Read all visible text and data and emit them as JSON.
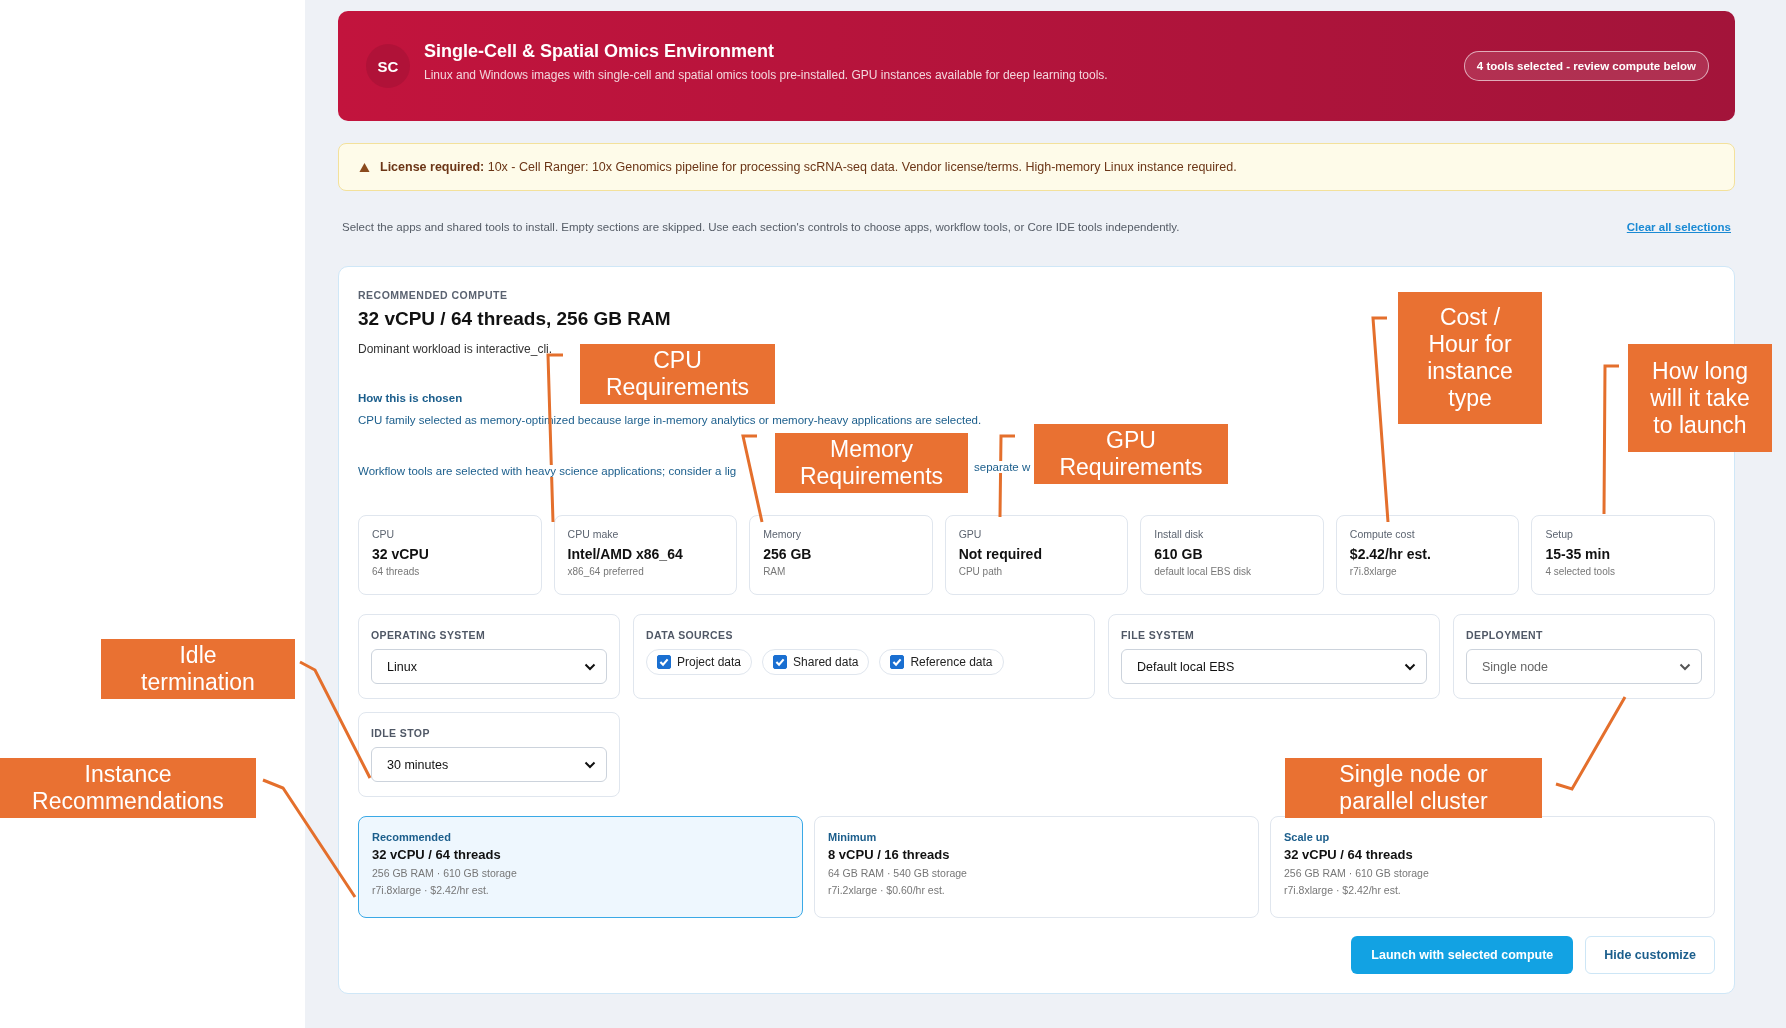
{
  "header": {
    "logo": "SC",
    "title": "Single-Cell & Spatial Omics Environment",
    "subtitle": "Linux and Windows images with single-cell and spatial omics tools pre-installed. GPU instances available for deep learning tools.",
    "badge": "4 tools selected - review compute below"
  },
  "license": {
    "label": "License required:",
    "text": "10x - Cell Ranger: 10x Genomics pipeline for processing scRNA-seq data. Vendor license/terms. High-memory Linux instance required."
  },
  "intro": "Select the apps and shared tools to install. Empty sections are skipped. Use each section's controls to choose apps, workflow tools, or Core IDE tools independently.",
  "clear_link": "Clear all selections",
  "compute": {
    "section_label": "RECOMMENDED COMPUTE",
    "title": "32 vCPU / 64 threads, 256 GB RAM",
    "dominant": "Dominant workload is interactive_cli.",
    "how_heading": "How this is chosen",
    "cpu_note": "CPU family selected as memory-optimized because large in-memory analytics or memory-heavy applications are selected.",
    "workflow_note": [
      "Workflow tools are selected with heavy science applications; consider a lig",
      "separate w"
    ]
  },
  "metrics": [
    {
      "label": "CPU",
      "value": "32 vCPU",
      "sub": "64 threads"
    },
    {
      "label": "CPU make",
      "value": "Intel/AMD x86_64",
      "sub": "x86_64 preferred"
    },
    {
      "label": "Memory",
      "value": "256 GB",
      "sub": "RAM"
    },
    {
      "label": "GPU",
      "value": "Not required",
      "sub": "CPU path"
    },
    {
      "label": "Install disk",
      "value": "610 GB",
      "sub": "default local EBS disk"
    },
    {
      "label": "Compute cost",
      "value": "$2.42/hr est.",
      "sub": "r7i.8xlarge"
    },
    {
      "label": "Setup",
      "value": "15-35 min",
      "sub": "4 selected tools"
    }
  ],
  "controls": {
    "operating_system": {
      "label": "OPERATING SYSTEM",
      "value": "Linux",
      "disabled": false
    },
    "data_sources": {
      "label": "DATA SOURCES",
      "options": [
        {
          "label": "Project data",
          "checked": true
        },
        {
          "label": "Shared data",
          "checked": true
        },
        {
          "label": "Reference data",
          "checked": true
        }
      ]
    },
    "file_system": {
      "label": "FILE SYSTEM",
      "value": "Default local EBS",
      "disabled": false
    },
    "deployment": {
      "label": "DEPLOYMENT",
      "value": "Single node",
      "disabled": true
    },
    "idle_stop": {
      "label": "IDLE STOP",
      "value": "30 minutes",
      "disabled": false
    }
  },
  "options": [
    {
      "kicker": "Recommended",
      "title": "32 vCPU / 64 threads",
      "specs": "256 GB RAM · 610 GB storage",
      "price": "r7i.8xlarge · $2.42/hr est.",
      "selected": true
    },
    {
      "kicker": "Minimum",
      "title": "8 vCPU / 16 threads",
      "specs": "64 GB RAM · 540 GB storage",
      "price": "r7i.2xlarge · $0.60/hr est.",
      "selected": false
    },
    {
      "kicker": "Scale up",
      "title": "32 vCPU / 64 threads",
      "specs": "256 GB RAM · 610 GB storage",
      "price": "r7i.8xlarge · $2.42/hr est.",
      "selected": false
    }
  ],
  "buttons": [
    "Launch with selected compute",
    "Hide customize"
  ],
  "annotations": [
    "CPU Requirements",
    "Memory Requirements",
    "GPU Requirements",
    "Cost / Hour for instance type",
    "How long will it take to launch",
    "Idle termination",
    "Instance Recommendations",
    "Single node or parallel cluster"
  ]
}
